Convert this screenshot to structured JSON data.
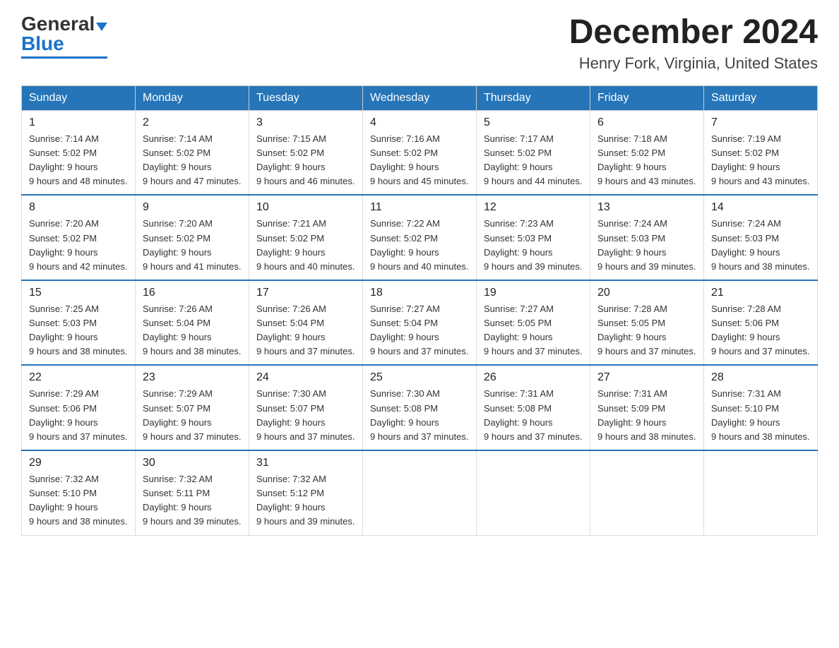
{
  "header": {
    "logo_general": "General",
    "logo_blue": "Blue",
    "main_title": "December 2024",
    "subtitle": "Henry Fork, Virginia, United States"
  },
  "days_of_week": [
    "Sunday",
    "Monday",
    "Tuesday",
    "Wednesday",
    "Thursday",
    "Friday",
    "Saturday"
  ],
  "weeks": [
    [
      {
        "day": "1",
        "sunrise": "7:14 AM",
        "sunset": "5:02 PM",
        "daylight": "9 hours and 48 minutes."
      },
      {
        "day": "2",
        "sunrise": "7:14 AM",
        "sunset": "5:02 PM",
        "daylight": "9 hours and 47 minutes."
      },
      {
        "day": "3",
        "sunrise": "7:15 AM",
        "sunset": "5:02 PM",
        "daylight": "9 hours and 46 minutes."
      },
      {
        "day": "4",
        "sunrise": "7:16 AM",
        "sunset": "5:02 PM",
        "daylight": "9 hours and 45 minutes."
      },
      {
        "day": "5",
        "sunrise": "7:17 AM",
        "sunset": "5:02 PM",
        "daylight": "9 hours and 44 minutes."
      },
      {
        "day": "6",
        "sunrise": "7:18 AM",
        "sunset": "5:02 PM",
        "daylight": "9 hours and 43 minutes."
      },
      {
        "day": "7",
        "sunrise": "7:19 AM",
        "sunset": "5:02 PM",
        "daylight": "9 hours and 43 minutes."
      }
    ],
    [
      {
        "day": "8",
        "sunrise": "7:20 AM",
        "sunset": "5:02 PM",
        "daylight": "9 hours and 42 minutes."
      },
      {
        "day": "9",
        "sunrise": "7:20 AM",
        "sunset": "5:02 PM",
        "daylight": "9 hours and 41 minutes."
      },
      {
        "day": "10",
        "sunrise": "7:21 AM",
        "sunset": "5:02 PM",
        "daylight": "9 hours and 40 minutes."
      },
      {
        "day": "11",
        "sunrise": "7:22 AM",
        "sunset": "5:02 PM",
        "daylight": "9 hours and 40 minutes."
      },
      {
        "day": "12",
        "sunrise": "7:23 AM",
        "sunset": "5:03 PM",
        "daylight": "9 hours and 39 minutes."
      },
      {
        "day": "13",
        "sunrise": "7:24 AM",
        "sunset": "5:03 PM",
        "daylight": "9 hours and 39 minutes."
      },
      {
        "day": "14",
        "sunrise": "7:24 AM",
        "sunset": "5:03 PM",
        "daylight": "9 hours and 38 minutes."
      }
    ],
    [
      {
        "day": "15",
        "sunrise": "7:25 AM",
        "sunset": "5:03 PM",
        "daylight": "9 hours and 38 minutes."
      },
      {
        "day": "16",
        "sunrise": "7:26 AM",
        "sunset": "5:04 PM",
        "daylight": "9 hours and 38 minutes."
      },
      {
        "day": "17",
        "sunrise": "7:26 AM",
        "sunset": "5:04 PM",
        "daylight": "9 hours and 37 minutes."
      },
      {
        "day": "18",
        "sunrise": "7:27 AM",
        "sunset": "5:04 PM",
        "daylight": "9 hours and 37 minutes."
      },
      {
        "day": "19",
        "sunrise": "7:27 AM",
        "sunset": "5:05 PM",
        "daylight": "9 hours and 37 minutes."
      },
      {
        "day": "20",
        "sunrise": "7:28 AM",
        "sunset": "5:05 PM",
        "daylight": "9 hours and 37 minutes."
      },
      {
        "day": "21",
        "sunrise": "7:28 AM",
        "sunset": "5:06 PM",
        "daylight": "9 hours and 37 minutes."
      }
    ],
    [
      {
        "day": "22",
        "sunrise": "7:29 AM",
        "sunset": "5:06 PM",
        "daylight": "9 hours and 37 minutes."
      },
      {
        "day": "23",
        "sunrise": "7:29 AM",
        "sunset": "5:07 PM",
        "daylight": "9 hours and 37 minutes."
      },
      {
        "day": "24",
        "sunrise": "7:30 AM",
        "sunset": "5:07 PM",
        "daylight": "9 hours and 37 minutes."
      },
      {
        "day": "25",
        "sunrise": "7:30 AM",
        "sunset": "5:08 PM",
        "daylight": "9 hours and 37 minutes."
      },
      {
        "day": "26",
        "sunrise": "7:31 AM",
        "sunset": "5:08 PM",
        "daylight": "9 hours and 37 minutes."
      },
      {
        "day": "27",
        "sunrise": "7:31 AM",
        "sunset": "5:09 PM",
        "daylight": "9 hours and 38 minutes."
      },
      {
        "day": "28",
        "sunrise": "7:31 AM",
        "sunset": "5:10 PM",
        "daylight": "9 hours and 38 minutes."
      }
    ],
    [
      {
        "day": "29",
        "sunrise": "7:32 AM",
        "sunset": "5:10 PM",
        "daylight": "9 hours and 38 minutes."
      },
      {
        "day": "30",
        "sunrise": "7:32 AM",
        "sunset": "5:11 PM",
        "daylight": "9 hours and 39 minutes."
      },
      {
        "day": "31",
        "sunrise": "7:32 AM",
        "sunset": "5:12 PM",
        "daylight": "9 hours and 39 minutes."
      },
      null,
      null,
      null,
      null
    ]
  ],
  "labels": {
    "sunrise": "Sunrise:",
    "sunset": "Sunset:",
    "daylight": "Daylight:"
  }
}
